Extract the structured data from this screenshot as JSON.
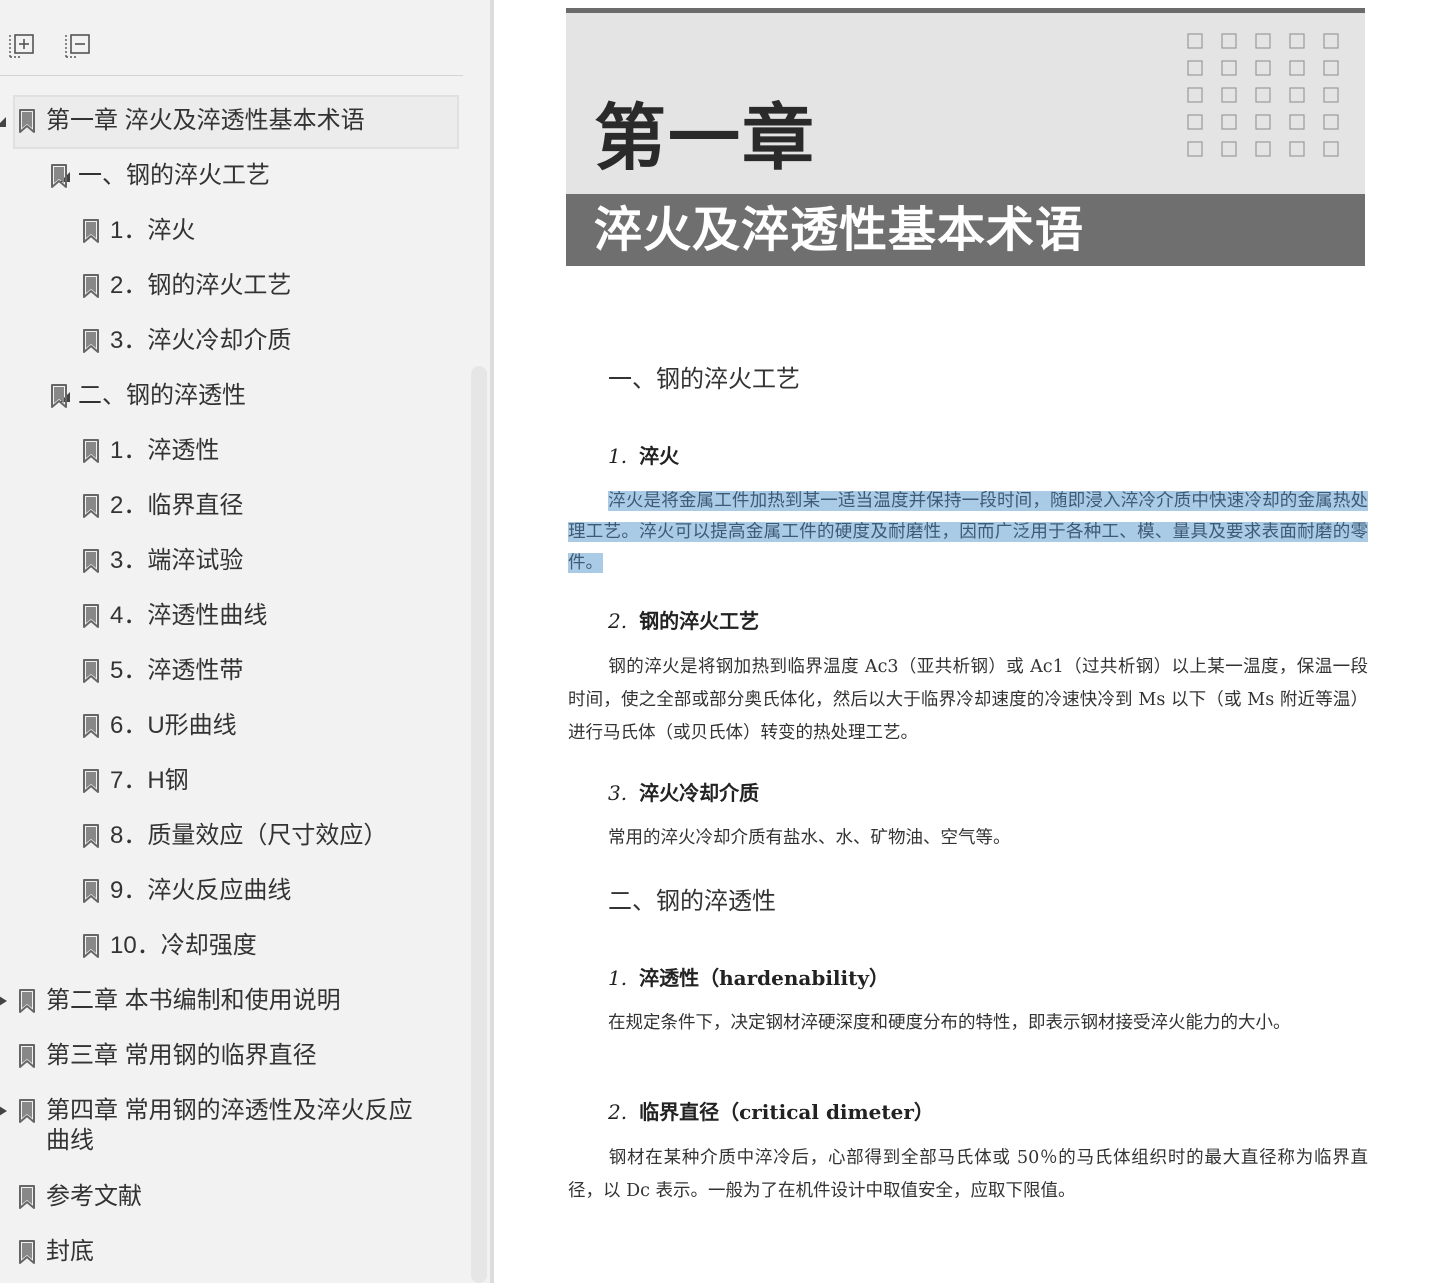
{
  "sidebar": {
    "toolbar": {
      "expand_all": "expand-all",
      "collapse_all": "collapse-all"
    },
    "bookmarks": [
      {
        "label": "第一章  淬火及淬透性基本术语",
        "level": 0,
        "caret": "expanded",
        "selected": true
      },
      {
        "label": "一、钢的淬火工艺",
        "level": 1,
        "caret": "expanded"
      },
      {
        "label": "1．淬火",
        "level": 2,
        "caret": "none"
      },
      {
        "label": "2．钢的淬火工艺",
        "level": 2,
        "caret": "none"
      },
      {
        "label": "3．淬火冷却介质",
        "level": 2,
        "caret": "none"
      },
      {
        "label": "二、钢的淬透性",
        "level": 1,
        "caret": "expanded"
      },
      {
        "label": "1．淬透性",
        "level": 2,
        "caret": "none"
      },
      {
        "label": "2．临界直径",
        "level": 2,
        "caret": "none"
      },
      {
        "label": "3．端淬试验",
        "level": 2,
        "caret": "none"
      },
      {
        "label": "4．淬透性曲线",
        "level": 2,
        "caret": "none"
      },
      {
        "label": "5．淬透性带",
        "level": 2,
        "caret": "none"
      },
      {
        "label": "6．U形曲线",
        "level": 2,
        "caret": "none"
      },
      {
        "label": "7．H钢",
        "level": 2,
        "caret": "none"
      },
      {
        "label": "8．质量效应（尺寸效应）",
        "level": 2,
        "caret": "none"
      },
      {
        "label": "9．淬火反应曲线",
        "level": 2,
        "caret": "none"
      },
      {
        "label": "10．冷却强度",
        "level": 2,
        "caret": "none"
      },
      {
        "label": "第二章  本书编制和使用说明",
        "level": 0,
        "caret": "collapsed"
      },
      {
        "label": "第三章  常用钢的临界直径",
        "level": 0,
        "caret": "none"
      },
      {
        "label": "第四章  常用钢的淬透性及淬火反应曲线",
        "level": 0,
        "caret": "collapsed",
        "tall": true
      },
      {
        "label": "参考文献",
        "level": 0,
        "caret": "none"
      },
      {
        "label": "封底",
        "level": 0,
        "caret": "none"
      }
    ]
  },
  "page": {
    "chapter_number": "第一章",
    "chapter_title": "淬火及淬透性基本术语",
    "section1": {
      "heading": "一、钢的淬火工艺",
      "items": [
        {
          "num": "1.",
          "title": "淬火",
          "text": "淬火是将金属工件加热到某一适当温度并保持一段时间，随即浸入淬冷介质中快速冷却的金属热处理工艺。淬火可以提高金属工件的硬度及耐磨性，因而广泛用于各种工、模、量具及要求表面耐磨的零件。"
        },
        {
          "num": "2.",
          "title": "钢的淬火工艺",
          "text": "钢的淬火是将钢加热到临界温度 Ac3（亚共析钢）或 Ac1（过共析钢）以上某一温度，保温一段时间，使之全部或部分奥氏体化，然后以大于临界冷却速度的冷速快冷到 Ms 以下（或 Ms 附近等温）进行马氏体（或贝氏体）转变的热处理工艺。"
        },
        {
          "num": "3.",
          "title": "淬火冷却介质",
          "text": "常用的淬火冷却介质有盐水、水、矿物油、空气等。"
        }
      ]
    },
    "section2": {
      "heading": "二、钢的淬透性",
      "items": [
        {
          "num": "1.",
          "title": "淬透性（hardenability）",
          "text": "在规定条件下，决定钢材淬硬深度和硬度分布的特性，即表示钢材接受淬火能力的大小。"
        },
        {
          "num": "2.",
          "title": "临界直径（critical dimeter）",
          "text": "钢材在某种介质中淬冷后，心部得到全部马氏体或 50％的马氏体组织时的最大直径称为临界直径，以 Dc 表示。一般为了在机件设计中取值安全，应取下限值。"
        }
      ]
    },
    "colors": {
      "highlight": "#a9cbe6",
      "banner_light": "#e4e4e4",
      "banner_dark": "#6f6f6f"
    }
  }
}
